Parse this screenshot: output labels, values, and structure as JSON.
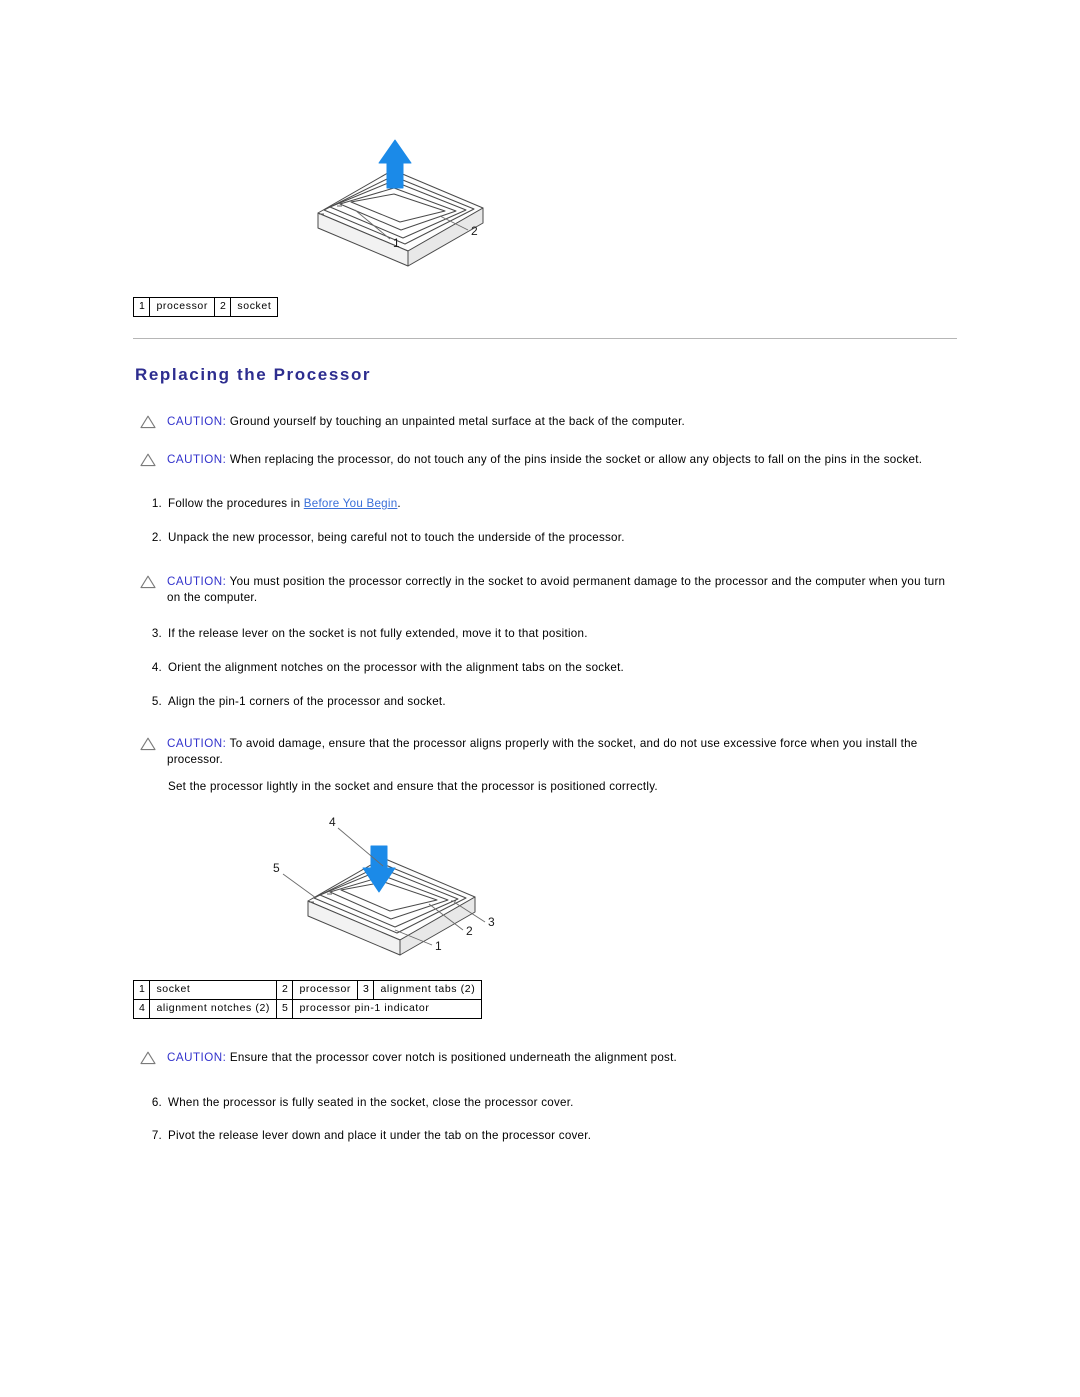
{
  "figure_top": {
    "name": "processor-removal-illustration",
    "arrow_direction": "up",
    "arrow_color": "#1b8ae8",
    "callouts": [
      "1",
      "2"
    ]
  },
  "legend_top": {
    "rows": [
      [
        {
          "num": "1",
          "label": "processor"
        },
        {
          "num": "2",
          "label": "socket"
        }
      ]
    ]
  },
  "section": {
    "title": "Replacing the Processor"
  },
  "cautions": {
    "label": "CAUTION:",
    "c1": " Ground yourself by touching an unpainted metal surface at the back of the computer.",
    "c2": " When replacing the processor, do not touch any of the pins inside the socket or allow any objects to fall on the pins in the socket.",
    "c3": " You must position the processor correctly in the socket to avoid permanent damage to the processor and the computer when you turn on the computer.",
    "c4": " To avoid damage, ensure that the processor aligns properly with the socket, and do not use excessive force when you install the processor.",
    "c5": " Ensure that the processor cover notch is positioned underneath the alignment post."
  },
  "steps": {
    "s1_num": "1.",
    "s1_pre": "Follow the procedures in ",
    "s1_link": "Before You Begin",
    "s1_post": ".",
    "s2_num": "2.",
    "s2_text": "Unpack the new processor, being careful not to touch the underside of the processor.",
    "s3_num": "3.",
    "s3_text": "If the release lever on the socket is not fully extended, move it to that position.",
    "s4_num": "4.",
    "s4_text": "Orient the alignment notches on the processor with the alignment tabs on the socket.",
    "s5_num": "5.",
    "s5_text": "Align the pin-1 corners of the processor and socket.",
    "set_text": "Set the processor lightly in the socket and ensure that the processor is positioned correctly.",
    "s6_num": "6.",
    "s6_text": "When the processor is fully seated in the socket, close the processor cover.",
    "s7_num": "7.",
    "s7_text": "Pivot the release lever down and place it under the tab on the processor cover."
  },
  "figure_bottom": {
    "name": "processor-installation-illustration",
    "arrow_direction": "down",
    "arrow_color": "#1b8ae8",
    "callouts": [
      "1",
      "2",
      "3",
      "4",
      "5"
    ]
  },
  "legend_bottom": {
    "rows": [
      [
        {
          "num": "1",
          "label": "socket"
        },
        {
          "num": "2",
          "label": "processor"
        },
        {
          "num": "3",
          "label": "alignment tabs (2)"
        }
      ],
      [
        {
          "num": "4",
          "label": "alignment notches (2)"
        },
        {
          "num": "5",
          "label": "processor pin-1 indicator"
        }
      ]
    ]
  }
}
